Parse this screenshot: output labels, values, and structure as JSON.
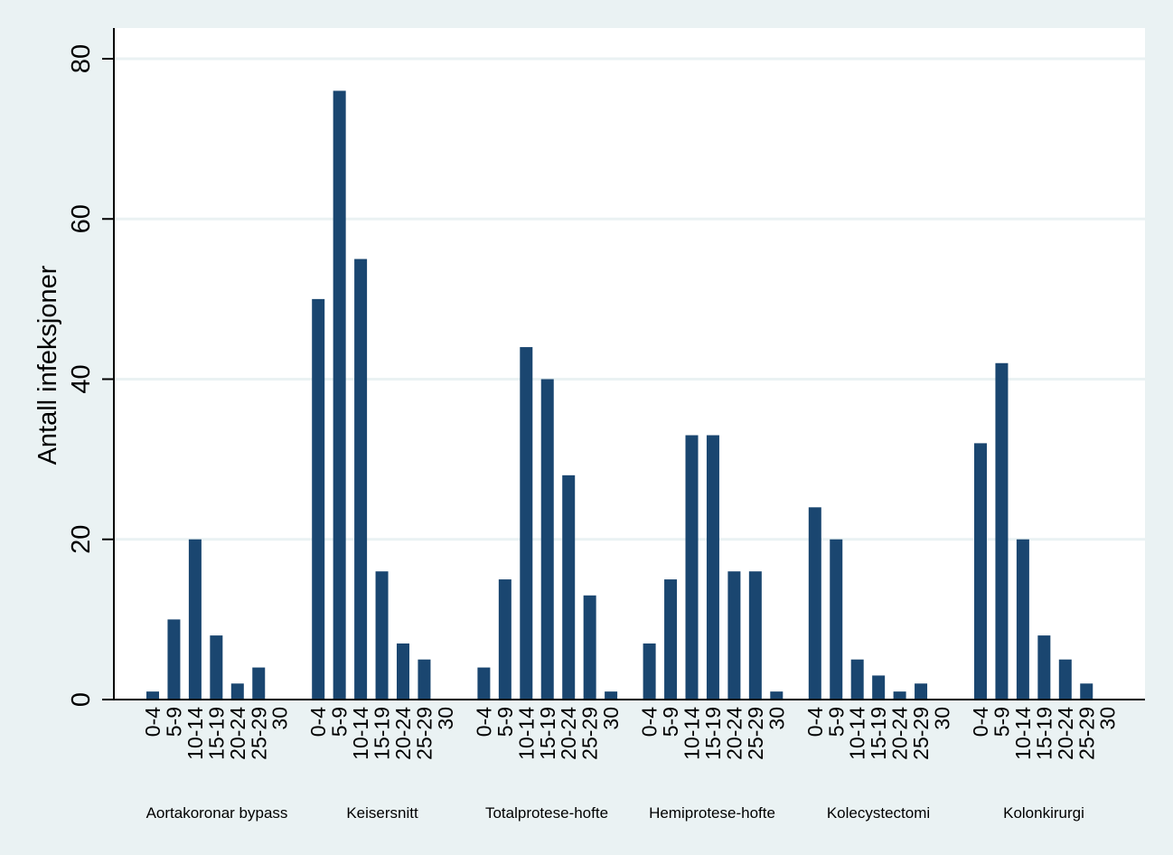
{
  "chart_data": {
    "type": "bar",
    "title": "",
    "xlabel": "",
    "ylabel": "Antall infeksjoner",
    "ylim": [
      0,
      83
    ],
    "yticks": [
      0,
      20,
      40,
      60,
      80
    ],
    "grid": true,
    "legend": "none",
    "bar_color": "#1a4670",
    "categories": [
      "0-4",
      "5-9",
      "10-14",
      "15-19",
      "20-24",
      "25-29",
      "30"
    ],
    "groups": [
      {
        "name": "Aortakoronar bypass",
        "values": [
          1,
          10,
          20,
          8,
          2,
          4,
          0
        ]
      },
      {
        "name": "Keisersnitt",
        "values": [
          50,
          76,
          55,
          16,
          7,
          5,
          0
        ]
      },
      {
        "name": "Totalprotese-hofte",
        "values": [
          4,
          15,
          44,
          40,
          28,
          13,
          1
        ]
      },
      {
        "name": "Hemiprotese-hofte",
        "values": [
          7,
          15,
          33,
          33,
          16,
          16,
          1
        ]
      },
      {
        "name": "Kolecystectomi",
        "values": [
          24,
          20,
          5,
          3,
          1,
          2,
          0
        ]
      },
      {
        "name": "Kolonkirurgi",
        "values": [
          32,
          42,
          20,
          8,
          5,
          2,
          0
        ]
      }
    ]
  }
}
